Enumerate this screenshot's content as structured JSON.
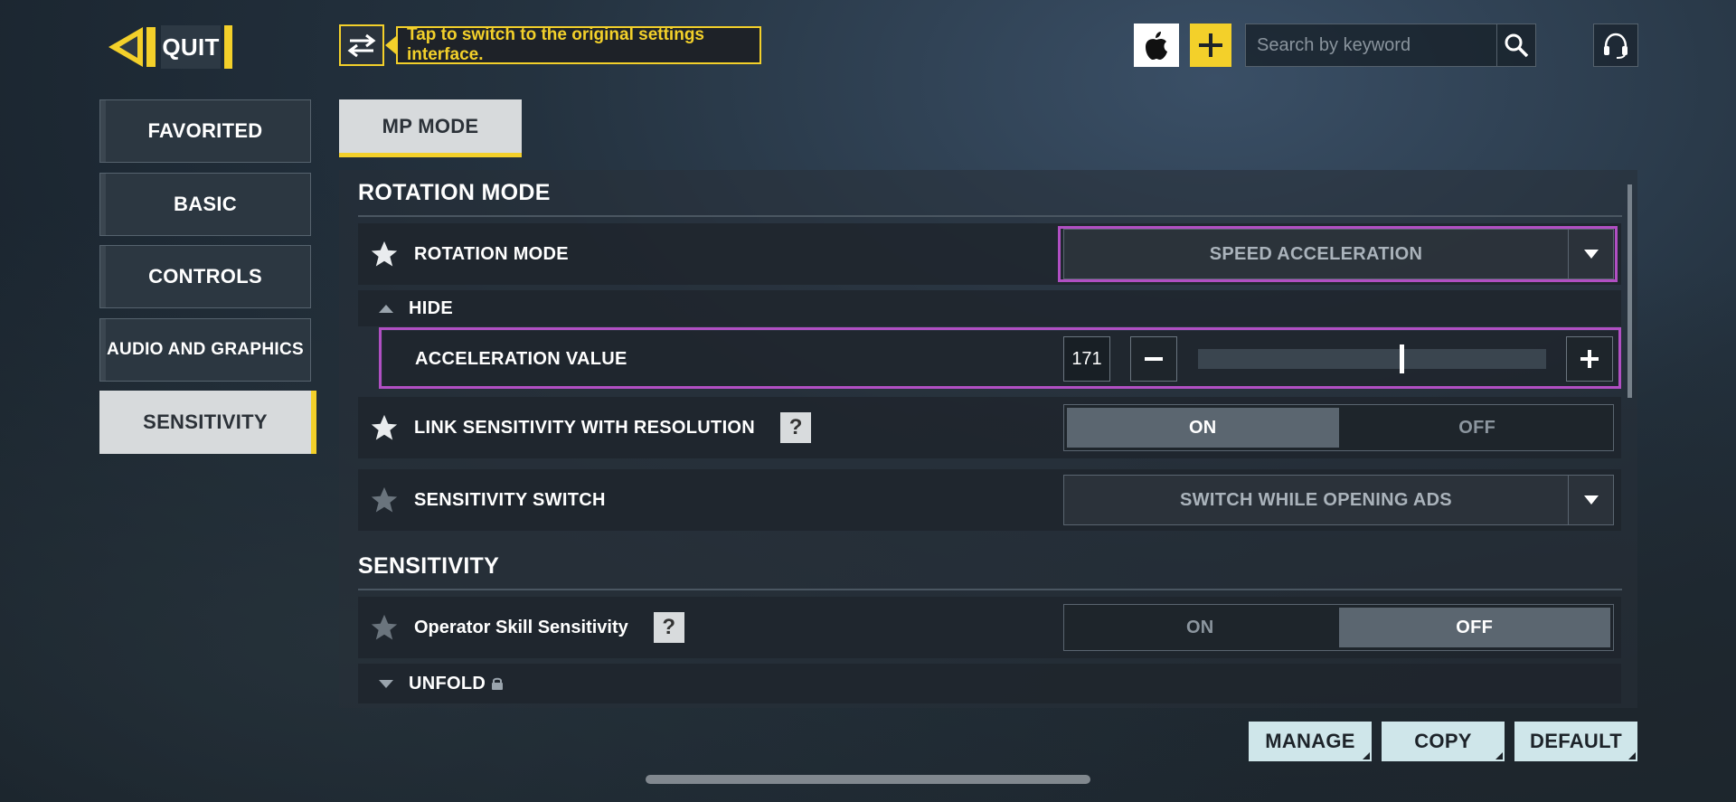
{
  "header": {
    "quit_label": "QUIT",
    "switch_tooltip": "Tap to switch to the original settings interface.",
    "search_placeholder": "Search by keyword",
    "icons": [
      "back-arrow-icon",
      "switch-arrows-icon",
      "apple-icon",
      "plus-icon",
      "search-icon",
      "headset-icon"
    ]
  },
  "sidebar": {
    "items": [
      {
        "label": "FAVORITED",
        "active": false
      },
      {
        "label": "BASIC",
        "active": false
      },
      {
        "label": "CONTROLS",
        "active": false
      },
      {
        "label": "AUDIO AND GRAPHICS",
        "active": false
      },
      {
        "label": "SENSITIVITY",
        "active": true
      }
    ]
  },
  "mode_tab": "MP MODE",
  "sections": {
    "rotation": {
      "title": "ROTATION MODE",
      "rotation_mode": {
        "label": "ROTATION MODE",
        "value": "SPEED ACCELERATION"
      },
      "hide_label": "HIDE",
      "acceleration": {
        "label": "ACCELERATION VALUE",
        "value": "171",
        "slider_fraction": 0.58
      },
      "link_sensitivity": {
        "label": "LINK SENSITIVITY WITH RESOLUTION",
        "on": "ON",
        "off": "OFF",
        "selected": "ON"
      },
      "sensitivity_switch": {
        "label": "SENSITIVITY SWITCH",
        "value": "SWITCH WHILE OPENING ADS"
      }
    },
    "sensitivity": {
      "title": "SENSITIVITY",
      "operator_skill": {
        "label": "Operator Skill Sensitivity",
        "on": "ON",
        "off": "OFF",
        "selected": "OFF"
      },
      "unfold_label": "UNFOLD"
    }
  },
  "help_glyph": "?",
  "footer": {
    "manage": "MANAGE",
    "copy": "COPY",
    "default": "DEFAULT"
  },
  "colors": {
    "accent": "#f3d02a",
    "highlight": "#b14fc3"
  }
}
